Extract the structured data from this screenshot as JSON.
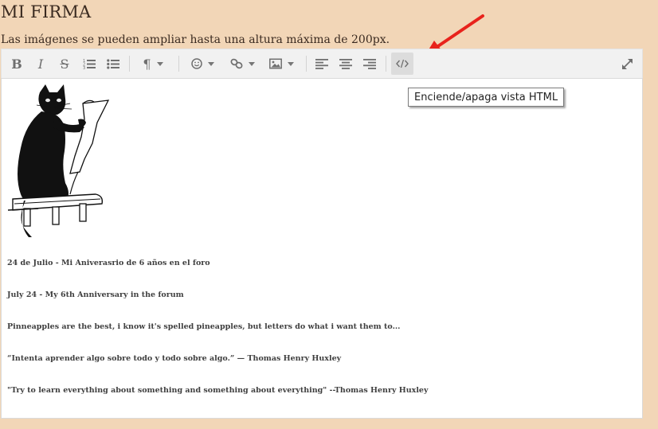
{
  "page": {
    "title": "MI FIRMA",
    "subtitle": "Las imágenes se pueden ampliar hasta una altura máxima de 200px."
  },
  "toolbar": {
    "bold_label": "B",
    "italic_label": "I",
    "strike_label": "S",
    "paragraph_label": "¶"
  },
  "tooltip": {
    "text": "Enciende/apaga vista HTML"
  },
  "editor": {
    "image_description": "black cat holding a sheet of paper",
    "lines": [
      "24 de Julio - Mi Aniverasrio de 6 años en el foro",
      "July 24 - My 6th Anniversary in the forum",
      "Pinneapples are the best, i know it's spelled pineapples, but letters do what i want them to...",
      "“Intenta aprender algo sobre todo y todo sobre algo.” — Thomas Henry Huxley",
      "\"Try to learn everything about something and something about everything\" --Thomas Henry Huxley"
    ]
  },
  "colors": {
    "background": "#f2d6b7",
    "toolbar": "#f1f1f1",
    "arrow": "#e8231c",
    "icon": "#6f6f6f"
  }
}
